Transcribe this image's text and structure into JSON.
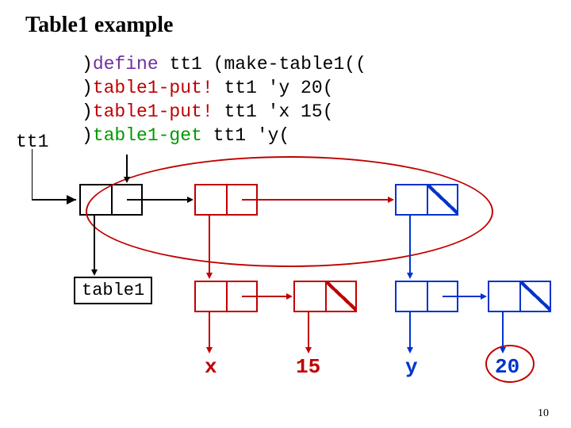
{
  "title": "Table1 example",
  "code_lines": {
    "l1": {
      "open": ")",
      "kw": "define",
      "rest": " tt1 (make-table1(("
    },
    "l2": {
      "open": ")",
      "kw": "table1-put!",
      "rest": " tt1 'y 20("
    },
    "l3": {
      "open": ")",
      "kw": "table1-put!",
      "rest": " tt1 'x 15("
    },
    "l4": {
      "open": ")",
      "kw": "table1-get",
      "rest": " tt1 'y("
    }
  },
  "tt1_label": "tt1",
  "table_label": "table1",
  "values": {
    "x": "x",
    "v15": "15",
    "y": "y",
    "v20": "20"
  },
  "page_number": "10"
}
